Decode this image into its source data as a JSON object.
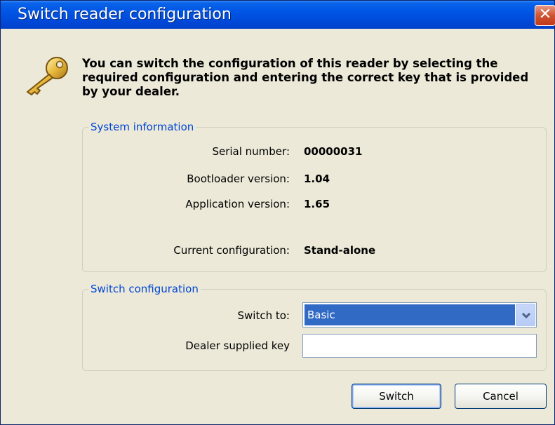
{
  "window": {
    "title": "Switch reader configuration",
    "close_label": "✕"
  },
  "icons": {
    "header_icon": "key-icon",
    "dropdown_icon": "chevron-down-icon"
  },
  "intro_text": "You can switch the configuration of this reader by selecting the required configuration and entering the correct key that is provided by your dealer.",
  "system_info": {
    "title": "System information",
    "serial_label": "Serial number:",
    "serial_value": "00000031",
    "bootloader_label": "Bootloader version:",
    "bootloader_value": "1.04",
    "application_label": "Application version:",
    "application_value": "1.65",
    "current_config_label": "Current configuration:",
    "current_config_value": "Stand-alone"
  },
  "switch_config": {
    "title": "Switch configuration",
    "switch_to_label": "Switch to:",
    "switch_to_value": "Basic",
    "key_label": "Dealer supplied key",
    "key_value": ""
  },
  "buttons": {
    "switch": "Switch",
    "cancel": "Cancel"
  },
  "colors": {
    "titlebar": "#0055e5",
    "group_title": "#0046d5",
    "selection": "#316ac5",
    "close_button": "#d0542f"
  }
}
